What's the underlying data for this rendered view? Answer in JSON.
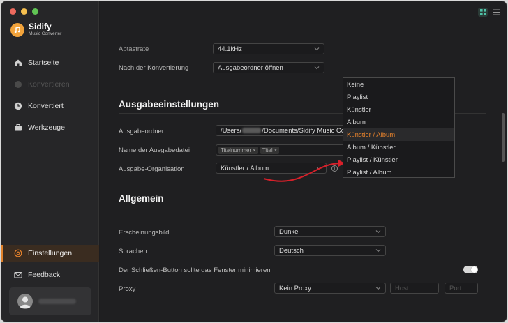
{
  "app": {
    "name": "Sidify",
    "subtitle": "Music Converter"
  },
  "sidebar": {
    "items": [
      {
        "label": "Startseite",
        "icon": "home-icon",
        "disabled": false,
        "active": false
      },
      {
        "label": "Konvertieren",
        "icon": "convert-icon",
        "disabled": true,
        "active": false
      },
      {
        "label": "Konvertiert",
        "icon": "clock-icon",
        "disabled": false,
        "active": false
      },
      {
        "label": "Werkzeuge",
        "icon": "toolbox-icon",
        "disabled": false,
        "active": false
      }
    ],
    "bottom_items": [
      {
        "label": "Einstellungen",
        "icon": "settings-icon",
        "active": true
      },
      {
        "label": "Feedback",
        "icon": "mail-icon",
        "active": false
      }
    ]
  },
  "settings": {
    "bitrate_label": "Abtastrate",
    "bitrate_value": "44.1kHz",
    "after_conversion_label": "Nach der Konvertierung",
    "after_conversion_value": "Ausgabeordner öffnen",
    "output_section_title": "Ausgabeeinstellungen",
    "output_folder_label": "Ausgabeordner",
    "output_folder_prefix": "/Users/",
    "output_folder_suffix": "/Documents/Sidify Music Co",
    "output_filename_label": "Name der Ausgabedatei",
    "filename_tags": [
      "Titelnummer",
      "Titel"
    ],
    "organization_label": "Ausgabe-Organisation",
    "organization_value": "Künstler / Album",
    "general_section_title": "Allgemein",
    "appearance_label": "Erscheinungsbild",
    "appearance_value": "Dunkel",
    "language_label": "Sprachen",
    "language_value": "Deutsch",
    "close_button_label": "Der Schließen-Button sollte das Fenster minimieren",
    "close_button_toggle": true,
    "proxy_label": "Proxy",
    "proxy_value": "Kein Proxy",
    "proxy_host_placeholder": "Host",
    "proxy_port_placeholder": "Port"
  },
  "dropdown": {
    "options": [
      "Keine",
      "Playlist",
      "Künstler",
      "Album",
      "Künstler / Album",
      "Album / Künstler",
      "Playlist / Künstler",
      "Playlist / Album"
    ],
    "selected": "Künstler / Album"
  },
  "colors": {
    "accent": "#e8832c",
    "traffic_red": "#ed6a5e",
    "traffic_yellow": "#f5bf4f",
    "traffic_green": "#61c554",
    "annotation_arrow": "#d8202a"
  }
}
